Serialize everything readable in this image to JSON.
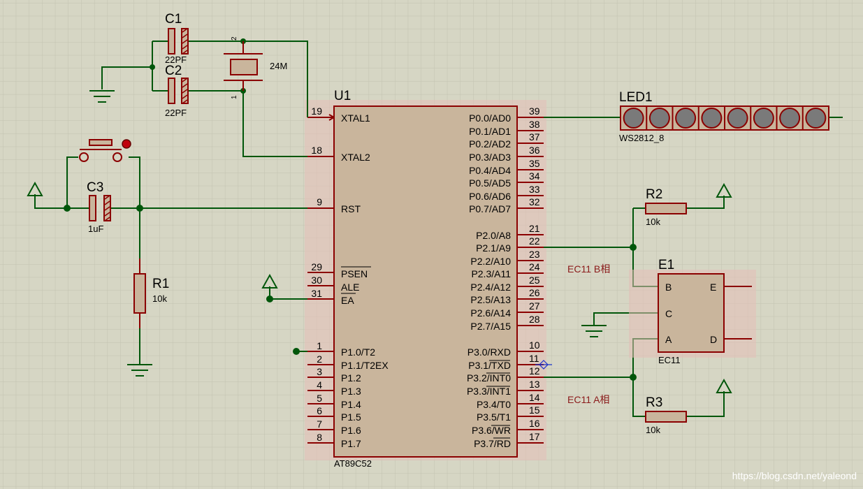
{
  "colors": {
    "background": "#d6d6c4",
    "grid": "#c2c2b0",
    "wire": "#00560a",
    "pin": "#8b0000",
    "component_fill": "#c9b59c",
    "highlight": "#e6bfb8",
    "terminal": "#005000",
    "led_fill": "#7a7a7a"
  },
  "u1": {
    "ref": "U1",
    "part": "AT89C52",
    "left_pins": [
      {
        "num": "19",
        "name": "XTAL1"
      },
      {
        "num": "18",
        "name": "XTAL2"
      },
      {
        "num": "9",
        "name": "RST"
      },
      {
        "num": "29",
        "name": "PSEN"
      },
      {
        "num": "30",
        "name": "ALE"
      },
      {
        "num": "31",
        "name": "EA"
      },
      {
        "num": "1",
        "name": "P1.0/T2"
      },
      {
        "num": "2",
        "name": "P1.1/T2EX"
      },
      {
        "num": "3",
        "name": "P1.2"
      },
      {
        "num": "4",
        "name": "P1.3"
      },
      {
        "num": "5",
        "name": "P1.4"
      },
      {
        "num": "6",
        "name": "P1.5"
      },
      {
        "num": "7",
        "name": "P1.6"
      },
      {
        "num": "8",
        "name": "P1.7"
      }
    ],
    "right_pins": [
      {
        "num": "39",
        "name": "P0.0/AD0"
      },
      {
        "num": "38",
        "name": "P0.1/AD1"
      },
      {
        "num": "37",
        "name": "P0.2/AD2"
      },
      {
        "num": "36",
        "name": "P0.3/AD3"
      },
      {
        "num": "35",
        "name": "P0.4/AD4"
      },
      {
        "num": "34",
        "name": "P0.5/AD5"
      },
      {
        "num": "33",
        "name": "P0.6/AD6"
      },
      {
        "num": "32",
        "name": "P0.7/AD7"
      },
      {
        "num": "21",
        "name": "P2.0/A8"
      },
      {
        "num": "22",
        "name": "P2.1/A9"
      },
      {
        "num": "23",
        "name": "P2.2/A10"
      },
      {
        "num": "24",
        "name": "P2.3/A11"
      },
      {
        "num": "25",
        "name": "P2.4/A12"
      },
      {
        "num": "26",
        "name": "P2.5/A13"
      },
      {
        "num": "27",
        "name": "P2.6/A14"
      },
      {
        "num": "28",
        "name": "P2.7/A15"
      },
      {
        "num": "10",
        "name": "P3.0/RXD"
      },
      {
        "num": "11",
        "name": "P3.1/TXD"
      },
      {
        "num": "12",
        "name": "P3.2/INT0"
      },
      {
        "num": "13",
        "name": "P3.3/INT1"
      },
      {
        "num": "14",
        "name": "P3.4/T0"
      },
      {
        "num": "15",
        "name": "P3.5/T1"
      },
      {
        "num": "16",
        "name": "P3.6/WR"
      },
      {
        "num": "17",
        "name": "P3.7/RD"
      }
    ]
  },
  "c1": {
    "ref": "C1",
    "value": "22PF"
  },
  "c2": {
    "ref": "C2",
    "value": "22PF"
  },
  "c3": {
    "ref": "C3",
    "value": "1uF"
  },
  "crystal": {
    "value": "24M",
    "pin1": "1",
    "pin2": "2"
  },
  "r1": {
    "ref": "R1",
    "value": "10k"
  },
  "r2": {
    "ref": "R2",
    "value": "10k"
  },
  "r3": {
    "ref": "R3",
    "value": "10k"
  },
  "led1": {
    "ref": "LED1",
    "part": "WS2812_8",
    "led_count": 8
  },
  "e1": {
    "ref": "E1",
    "part": "EC11",
    "pins": {
      "b": "B",
      "c": "C",
      "a": "A",
      "e": "E",
      "d": "D"
    }
  },
  "notes": {
    "b_phase": "EC11 B相",
    "a_phase": "EC11 A相"
  },
  "watermark": "https://blog.csdn.net/yaleond"
}
